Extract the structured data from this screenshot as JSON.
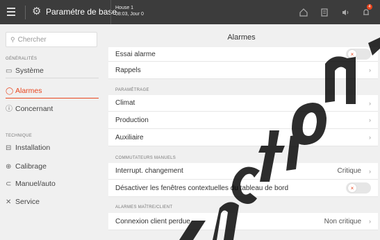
{
  "topbar": {
    "title": "Paramétre de base",
    "house_line1": "House 1",
    "house_line2": "08:03, Jour 0",
    "icons": [
      "home-icon",
      "document-icon",
      "speaker-icon",
      "bell-icon"
    ],
    "notification_count": "4"
  },
  "sidebar": {
    "search_placeholder": "Chercher",
    "sections": [
      {
        "label": "GÉNÉRALITÉS",
        "items": [
          {
            "label": "Système",
            "icon": "monitor-icon"
          },
          {
            "label": "Alarmes",
            "icon": "alarm-icon",
            "active": true
          },
          {
            "label": "Concernant",
            "icon": "info-icon"
          }
        ]
      },
      {
        "label": "TECHNIQUE",
        "items": [
          {
            "label": "Installation",
            "icon": "installation-icon"
          },
          {
            "label": "Calibrage",
            "icon": "calibrate-icon"
          },
          {
            "label": "Manuel/auto",
            "icon": "toggle-icon"
          },
          {
            "label": "Service",
            "icon": "wrench-icon"
          }
        ]
      }
    ]
  },
  "main": {
    "title": "Alarmes",
    "rows": {
      "essai": {
        "label": "Essai alarme"
      },
      "rappels": {
        "label": "Rappels"
      },
      "parametrage_label": "PARAMÉTRAGE",
      "climat": {
        "label": "Climat"
      },
      "production": {
        "label": "Production"
      },
      "auxiliaire": {
        "label": "Auxiliaire"
      },
      "commutateurs_label": "COMMUTATEURS MANUELS",
      "interrupt": {
        "label": "Interrupt. changement",
        "value": "Critique"
      },
      "desactiver": {
        "label": "Désactiver les fenêtres contextuelles du tableau de bord"
      },
      "maitre_label": "ALARMES MAÎTRE/CLIENT",
      "connexion": {
        "label": "Connexion client perdue",
        "value": "Non critique"
      }
    }
  },
  "colors": {
    "accent": "#e8451e",
    "topbar": "#3c3c3c",
    "background": "#f0f0f0"
  }
}
